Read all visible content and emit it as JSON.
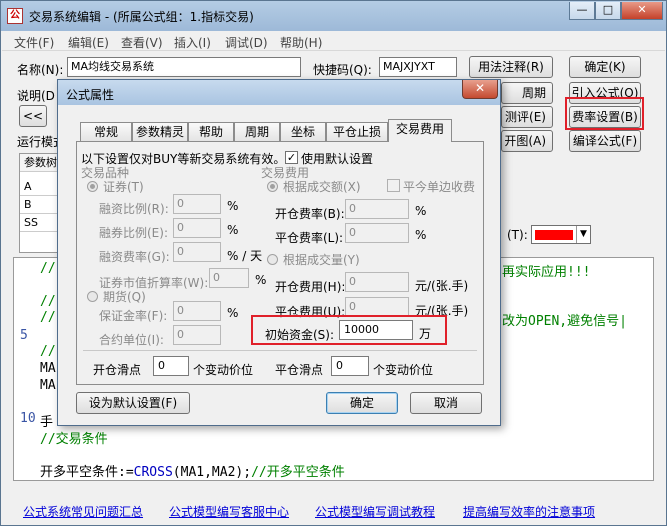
{
  "window": {
    "title": "交易系统编辑 - (所属公式组：1.指标交易)",
    "app_icon": "公",
    "minimize": "—",
    "maximize": "□",
    "close": "✕"
  },
  "menu": [
    "文件(F)",
    "编辑(E)",
    "查看(V)",
    "插入(I)",
    "调试(D)",
    "帮助(H)"
  ],
  "form": {
    "name_label": "名称(N):",
    "name_value": "MA均线交易系统",
    "code_label": "快捷码(Q):",
    "code_value": "MAJXJYXT",
    "desc_label": "说明(D",
    "run_label": "运行模式",
    "params_label": "参数树",
    "color_label": "(T):",
    "prev_button": "<<"
  },
  "params": [
    "A",
    "B",
    "SS"
  ],
  "buttons": {
    "usage_note": "用法注释(R)",
    "ok": "确定(K)",
    "import": "引入公式(O)",
    "period": "周期",
    "review": "测评(E)",
    "fee_setting": "费率设置(B)",
    "open_chart": "开图(A)",
    "compile": "编译公式(F)"
  },
  "colors": {
    "swatch": "#ff0000",
    "highlight": "#e0202a",
    "comment": "#008000",
    "keyword": "#0000c0"
  },
  "editor": {
    "line_numbers": [
      "5",
      "10"
    ],
    "line1": "//",
    "line1_tail": "再实际应用!!!",
    "line2": "//",
    "line3": "//",
    "line3_tail": "改为OPEN,避免信号|",
    "line4": "//",
    "line5": "MA",
    "line6": "MA",
    "line7": "手",
    "line8": "//交易条件",
    "line9_plain": "开多平空条件:=",
    "line9_func": "CROSS",
    "line9_args": "(MA1,MA2);",
    "line9_comment": "//开多平空条件"
  },
  "footer_links": [
    "公式系统常见问题汇总",
    "公式模型编写客服中心",
    "公式模型编写调试教程",
    "提高编写效率的注意事项"
  ],
  "dialog": {
    "title": "公式属性",
    "close": "✕",
    "tabs": [
      "常规",
      "参数精灵",
      "帮助",
      "周期",
      "坐标",
      "平仓止损",
      "交易费用"
    ],
    "active_tab": "交易费用",
    "intro": "以下设置仅对BUY等新交易系统有效。",
    "use_default_label": "使用默认设置",
    "trade_kind_label": "交易品种",
    "securities_label": "证券(T)",
    "margin_ratio_label": "融资比例(R):",
    "margin_ratio_value": "0",
    "short_ratio_label": "融券比例(E):",
    "short_ratio_value": "0",
    "financing_rate_label": "融资费率(G):",
    "financing_rate_value": "0",
    "percent": "%",
    "per_day": "% / 天",
    "market_factor_label": "证券市值折算率(W):",
    "market_factor_value": "0",
    "futures_label": "期货(Q)",
    "deposit_ratio_label": "保证金率(F):",
    "deposit_ratio_value": "0",
    "contract_unit_label": "合约单位(I):",
    "contract_unit_value": "0",
    "fee_label": "交易费用",
    "by_amount_label": "根据成交额(X)",
    "close_single_label": "平今单边收费",
    "open_rate_label": "开仓费率(B):",
    "open_rate_value": "0",
    "close_rate_label": "平仓费率(L):",
    "close_rate_value": "0",
    "by_volume_label": "根据成交量(Y)",
    "open_fee_label": "开仓费用(H):",
    "open_fee_value": "0",
    "close_fee_label": "平仓费用(U):",
    "close_fee_value": "0",
    "fee_unit": "元/(张.手)",
    "initial_capital_label": "初始资金(S):",
    "initial_capital_value": "10000",
    "wan": "万",
    "open_slip_label": "开仓滑点",
    "open_slip_value": "0",
    "close_slip_label": "平仓滑点",
    "close_slip_value": "0",
    "tick_unit": "个变动价位",
    "set_default_button": "设为默认设置(F)",
    "ok_button": "确定",
    "cancel_button": "取消",
    "checkmark": "✓"
  }
}
